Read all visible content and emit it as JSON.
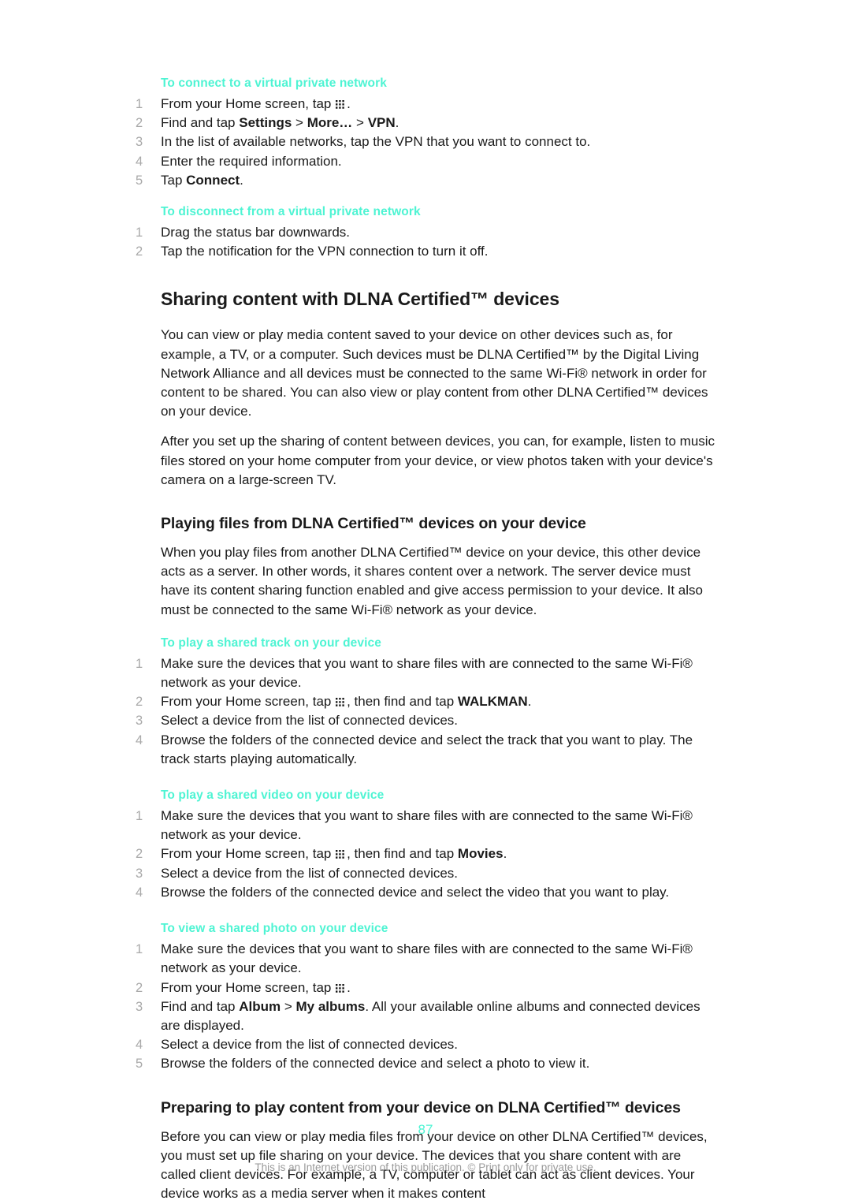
{
  "page": {
    "number": "87",
    "footnote": "This is an Internet version of this publication. © Print only for private use.",
    "accent_color": "#4ef4d3",
    "text_color": "#1a1a1a",
    "step_number_color": "#a9a9a9",
    "footnote_color": "#9a9a9a",
    "background": "#ffffff"
  },
  "icons": {
    "app_drawer": "app-drawer-grid-icon"
  },
  "sections": {
    "vpn_connect": {
      "heading": "To connect to a virtual private network",
      "steps": [
        {
          "num": "1",
          "pre": "From your Home screen, tap ",
          "icon": true,
          "post": "."
        },
        {
          "num": "2",
          "pre": "Find and tap ",
          "bold1": "Settings",
          "mid1": " > ",
          "bold2": "More…",
          "mid2": " > ",
          "bold3": "VPN",
          "post": "."
        },
        {
          "num": "3",
          "text": "In the list of available networks, tap the VPN that you want to connect to."
        },
        {
          "num": "4",
          "text": "Enter the required information."
        },
        {
          "num": "5",
          "pre": "Tap ",
          "bold1": "Connect",
          "post": "."
        }
      ]
    },
    "vpn_disconnect": {
      "heading": "To disconnect from a virtual private network",
      "steps": [
        {
          "num": "1",
          "text": "Drag the status bar downwards."
        },
        {
          "num": "2",
          "text": "Tap the notification for the VPN connection to turn it off."
        }
      ]
    },
    "sharing_dlna": {
      "heading": "Sharing content with DLNA Certified™ devices",
      "paragraph_1": "You can view or play media content saved to your device on other devices such as, for example, a TV, or a computer. Such devices must be DLNA Certified™ by the Digital Living Network Alliance and all devices must be connected to the same Wi-Fi® network in order for content to be shared. You can also view or play content from other DLNA Certified™ devices on your device.",
      "paragraph_2": "After you set up the sharing of content between devices, you can, for example, listen to music files stored on your home computer from your device, or view photos taken with your device's camera on a large-screen TV."
    },
    "playing_files": {
      "heading": "Playing files from DLNA Certified™ devices on your device",
      "paragraph_1": "When you play files from another DLNA Certified™ device on your device, this other device acts as a server. In other words, it shares content over a network. The server device must have its content sharing function enabled and give access permission to your device. It also must be connected to the same Wi-Fi® network as your device."
    },
    "shared_track": {
      "heading": "To play a shared track on your device",
      "steps": [
        {
          "num": "1",
          "text": "Make sure the devices that you want to share files with are connected to the same Wi-Fi® network as your device."
        },
        {
          "num": "2",
          "pre": "From your Home screen, tap ",
          "icon": true,
          "mid1": ", then find and tap ",
          "bold1": "WALKMAN",
          "post": "."
        },
        {
          "num": "3",
          "text": "Select a device from the list of connected devices."
        },
        {
          "num": "4",
          "text": "Browse the folders of the connected device and select the track that you want to play. The track starts playing automatically."
        }
      ]
    },
    "shared_video": {
      "heading": "To play a shared video on your device",
      "steps": [
        {
          "num": "1",
          "text": "Make sure the devices that you want to share files with are connected to the same Wi-Fi® network as your device."
        },
        {
          "num": "2",
          "pre": "From your Home screen, tap ",
          "icon": true,
          "mid1": ", then find and tap ",
          "bold1": "Movies",
          "post": "."
        },
        {
          "num": "3",
          "text": "Select a device from the list of connected devices."
        },
        {
          "num": "4",
          "text": "Browse the folders of the connected device and select the video that you want to play."
        }
      ]
    },
    "shared_photo": {
      "heading": "To view a shared photo on your device",
      "steps": [
        {
          "num": "1",
          "text": "Make sure the devices that you want to share files with are connected to the same Wi-Fi® network as your device."
        },
        {
          "num": "2",
          "pre": "From your Home screen, tap ",
          "icon": true,
          "post": "."
        },
        {
          "num": "3",
          "pre": "Find and tap ",
          "bold1": "Album",
          "mid1": " > ",
          "bold2": "My albums",
          "post": ". All your available online albums and connected devices are displayed."
        },
        {
          "num": "4",
          "text": "Select a device from the list of connected devices."
        },
        {
          "num": "5",
          "text": "Browse the folders of the connected device and select a photo to view it."
        }
      ]
    },
    "preparing": {
      "heading": "Preparing to play content from your device on DLNA Certified™ devices",
      "paragraph_1": "Before you can view or play media files from your device on other DLNA Certified™ devices, you must set up file sharing on your device. The devices that you share content with are called client devices. For example, a TV, computer or tablet can act as client devices. Your device works as a media server when it makes content"
    }
  }
}
